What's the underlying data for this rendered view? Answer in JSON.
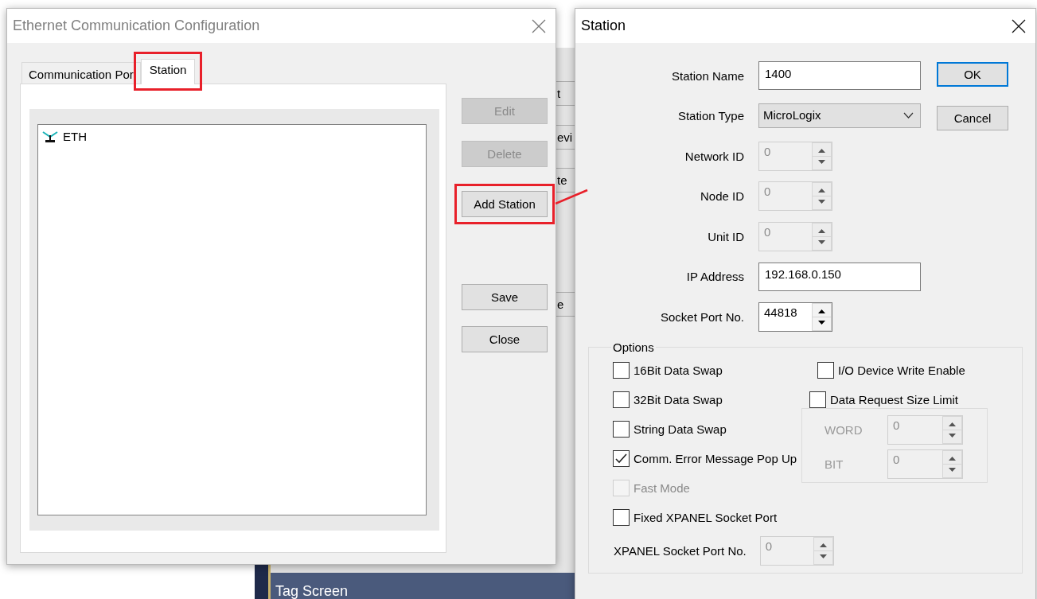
{
  "background_window": {
    "buttons": [
      "t",
      "evi",
      "te",
      "e"
    ],
    "panel_title": "Tag Screen"
  },
  "config_dialog": {
    "title": "Ethernet Communication Configuration",
    "tabs": [
      {
        "label": "Communication Por",
        "selected": false,
        "highlighted": false
      },
      {
        "label": "Station",
        "selected": true,
        "highlighted": true
      }
    ],
    "items": [
      {
        "label": "ETH"
      }
    ],
    "buttons": [
      {
        "label": "Edit",
        "disabled": true,
        "highlighted": false
      },
      {
        "label": "Delete",
        "disabled": true,
        "highlighted": false
      },
      {
        "label": "Add Station",
        "disabled": false,
        "highlighted": true
      },
      {
        "label": "Save",
        "disabled": false,
        "highlighted": false
      },
      {
        "label": "Close",
        "disabled": false,
        "highlighted": false
      }
    ]
  },
  "station_dialog": {
    "title": "Station",
    "fields": [
      {
        "kind": "text",
        "label": "Station Name",
        "value": "1400",
        "disabled": false
      },
      {
        "kind": "select",
        "label": "Station Type",
        "value": "MicroLogix",
        "disabled": false
      },
      {
        "kind": "spin",
        "label": "Network ID",
        "value": "0",
        "disabled": true
      },
      {
        "kind": "spin",
        "label": "Node ID",
        "value": "0",
        "disabled": true
      },
      {
        "kind": "spin",
        "label": "Unit ID",
        "value": "0",
        "disabled": true
      },
      {
        "kind": "text",
        "label": "IP Address",
        "value": "192.168.0.150",
        "disabled": false
      },
      {
        "kind": "spin",
        "label": "Socket Port No.",
        "value": "44818",
        "disabled": false
      }
    ],
    "buttons": [
      {
        "label": "OK",
        "default": true
      },
      {
        "label": "Cancel",
        "default": false
      }
    ],
    "options": {
      "title": "Options",
      "left": [
        {
          "label": "16Bit Data Swap",
          "checked": false,
          "disabled": false
        },
        {
          "label": "32Bit Data Swap",
          "checked": false,
          "disabled": false
        },
        {
          "label": "String Data Swap",
          "checked": false,
          "disabled": false
        },
        {
          "label": "Comm. Error Message Pop Up",
          "checked": true,
          "disabled": false
        },
        {
          "label": "Fast Mode",
          "checked": false,
          "disabled": true
        },
        {
          "label": "Fixed XPANEL Socket Port",
          "checked": false,
          "disabled": false
        }
      ],
      "right": [
        {
          "label": "I/O Device Write Enable",
          "checked": false,
          "disabled": false
        },
        {
          "label": "Data Request Size Limit",
          "checked": false,
          "disabled": false
        }
      ],
      "size_limits": [
        {
          "label": "WORD",
          "value": "0",
          "disabled": true
        },
        {
          "label": "BIT",
          "value": "0",
          "disabled": true
        }
      ],
      "xpanel_port": {
        "label": "XPANEL Socket Port No.",
        "value": "0",
        "disabled": true
      }
    }
  }
}
